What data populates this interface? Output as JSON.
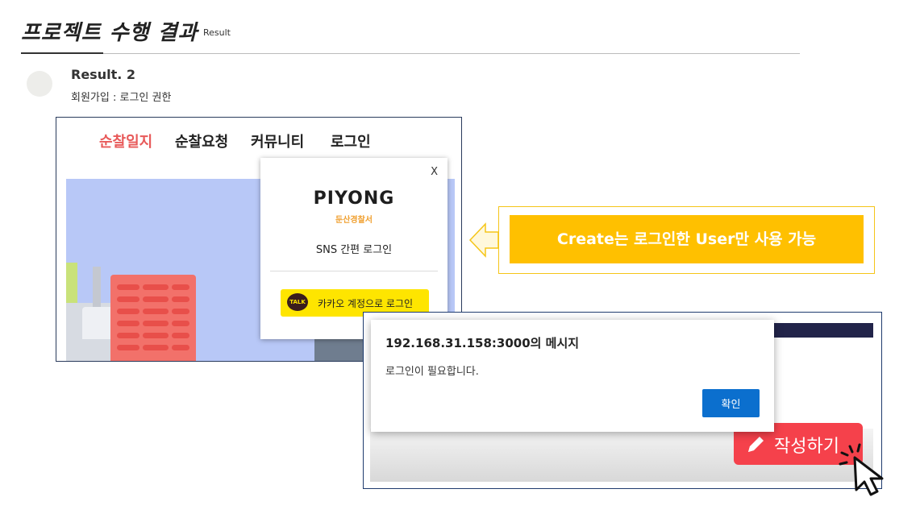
{
  "header": {
    "title": "프로젝트 수행 결과",
    "subtitle": "Result"
  },
  "result": {
    "title": "Result. 2",
    "description": "회원가입 : 로그인 권한"
  },
  "site_preview": {
    "nav": [
      {
        "label": "순찰일지",
        "active": true
      },
      {
        "label": "순찰요청",
        "active": false
      },
      {
        "label": "커뮤니티",
        "active": false
      },
      {
        "label": "로그인",
        "active": false
      }
    ],
    "login_modal": {
      "close_label": "X",
      "brand": "PIYONG",
      "brand_sub": "둔산경찰서",
      "sns_title": "SNS 간편 로그인",
      "kakao_icon_text": "TALK",
      "kakao_label": "카카오 계정으로 로그인"
    }
  },
  "callout": {
    "text": "Create는 로그인한 User만 사용 가능"
  },
  "alert_preview": {
    "dialog_title": "192.168.31.158:3000의 메시지",
    "dialog_message": "로그인이 필요합니다.",
    "ok_label": "확인",
    "write_button_label": "작성하기"
  },
  "colors": {
    "nav_active": "#e85a5a",
    "callout_fill": "#ffc000",
    "kakao_yellow": "#fee500",
    "ok_button": "#0b6fce",
    "write_button": "#f5414b"
  },
  "icons": [
    "pencil-icon",
    "kakao-talk-icon",
    "hand-cursor-icon",
    "close-icon",
    "left-arrow-icon"
  ]
}
